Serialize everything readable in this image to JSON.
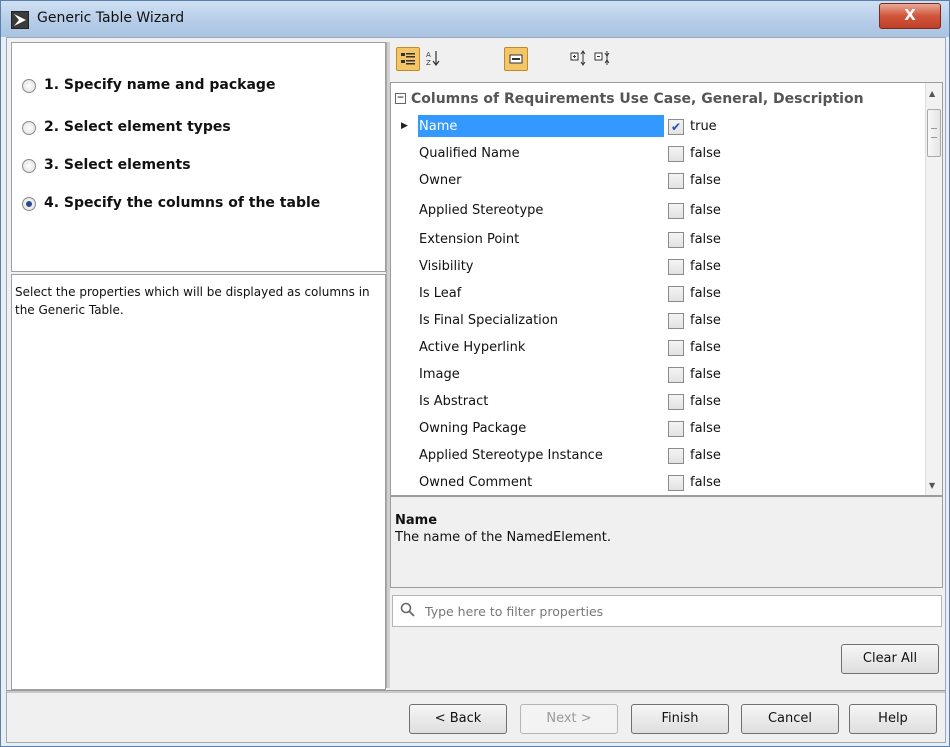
{
  "window": {
    "title": "Generic Table Wizard",
    "close_label": "X"
  },
  "steps": [
    {
      "label": "1. Specify name and package",
      "selected": false
    },
    {
      "label": "2. Select element types",
      "selected": false
    },
    {
      "label": "3. Select elements",
      "selected": false
    },
    {
      "label": "4. Specify the columns of the table",
      "selected": true
    }
  ],
  "description": "Select the properties which will be displayed as columns in the Generic Table.",
  "toolbar": {
    "icons": [
      "categorized-view-icon",
      "sort-alphabetical-icon",
      "show-all-icon",
      "expand-all-icon",
      "collapse-all-icon"
    ]
  },
  "grid": {
    "header": "Columns of  Requirements Use Case, General, Description",
    "collapse_glyph": "−",
    "rows": [
      {
        "name": "Name",
        "checked": true,
        "value": "true"
      },
      {
        "name": "Qualified Name",
        "checked": false,
        "value": "false"
      },
      {
        "name": "Owner",
        "checked": false,
        "value": "false"
      },
      {
        "name": "Applied Stereotype",
        "checked": false,
        "value": "false"
      },
      {
        "name": "Extension Point",
        "checked": false,
        "value": "false"
      },
      {
        "name": "Visibility",
        "checked": false,
        "value": "false"
      },
      {
        "name": "Is Leaf",
        "checked": false,
        "value": "false"
      },
      {
        "name": "Is Final Specialization",
        "checked": false,
        "value": "false"
      },
      {
        "name": "Active Hyperlink",
        "checked": false,
        "value": "false"
      },
      {
        "name": "Image",
        "checked": false,
        "value": "false"
      },
      {
        "name": "Is Abstract",
        "checked": false,
        "value": "false"
      },
      {
        "name": "Owning Package",
        "checked": false,
        "value": "false"
      },
      {
        "name": "Applied Stereotype Instance",
        "checked": false,
        "value": "false"
      },
      {
        "name": "Owned Comment",
        "checked": false,
        "value": "false"
      }
    ]
  },
  "info": {
    "title": "Name",
    "text": "The name of the NamedElement."
  },
  "filter": {
    "placeholder": "Type here to filter properties"
  },
  "buttons": {
    "clear_all": "Clear All",
    "back": "< Back",
    "next": "Next >",
    "finish": "Finish",
    "cancel": "Cancel",
    "help": "Help"
  }
}
